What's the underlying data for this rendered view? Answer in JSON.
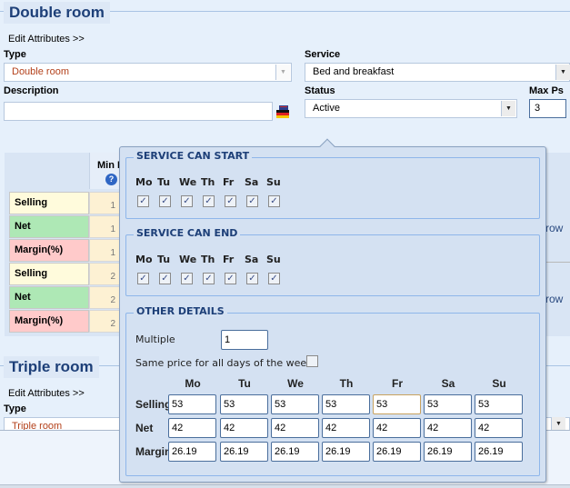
{
  "double_room": {
    "title": "Double room",
    "edit_attributes": "Edit Attributes >>",
    "type_label": "Type",
    "type_value": "Double room",
    "description_label": "Description",
    "description_value": "",
    "service_label": "Service",
    "service_value": "Bed and breakfast",
    "status_label": "Status",
    "status_value": "Active",
    "max_ps_label": "Max Ps",
    "max_ps_value": "3"
  },
  "grid": {
    "header": "Min I",
    "right_text_1": "row",
    "right_text_2": "row",
    "rows": [
      {
        "label": "Selling",
        "value": "1",
        "kind": "sell"
      },
      {
        "label": "Net",
        "value": "1",
        "kind": "net"
      },
      {
        "label": "Margin(%)",
        "value": "1",
        "kind": "marg"
      },
      {
        "label": "Selling",
        "value": "2",
        "kind": "sell"
      },
      {
        "label": "Net",
        "value": "2",
        "kind": "net"
      },
      {
        "label": "Margin(%)",
        "value": "2",
        "kind": "marg"
      }
    ]
  },
  "triple_room": {
    "title": "Triple room",
    "edit_attributes": "Edit Attributes >>",
    "type_label": "Type",
    "type_value": "Triple room"
  },
  "popup": {
    "service_can_start": {
      "title": "SERVICE CAN START",
      "days": [
        "Mo",
        "Tu",
        "We",
        "Th",
        "Fr",
        "Sa",
        "Su"
      ],
      "checked": [
        true,
        true,
        true,
        true,
        true,
        true,
        true
      ]
    },
    "service_can_end": {
      "title": "SERVICE CAN END",
      "days": [
        "Mo",
        "Tu",
        "We",
        "Th",
        "Fr",
        "Sa",
        "Su"
      ],
      "checked": [
        true,
        true,
        true,
        true,
        true,
        true,
        true
      ]
    },
    "other_details": {
      "title": "OTHER DETAILS",
      "multiple_label": "Multiple",
      "multiple_value": "1",
      "same_price_label": "Same price for all days of the week",
      "same_price_checked": false,
      "columns": [
        "Mo",
        "Tu",
        "We",
        "Th",
        "Fr",
        "Sa",
        "Su"
      ],
      "rows": [
        {
          "label": "Selling",
          "values": [
            "53",
            "53",
            "53",
            "53",
            "53",
            "53",
            "53"
          ]
        },
        {
          "label": "Net",
          "values": [
            "42",
            "42",
            "42",
            "42",
            "42",
            "42",
            "42"
          ]
        },
        {
          "label": "Margin",
          "values": [
            "26.19",
            "26.19",
            "26.19",
            "26.19",
            "26.19",
            "26.19",
            "26.19"
          ]
        }
      ]
    }
  },
  "colors": {
    "title": "#1d3f78",
    "type_value": "#b3401a",
    "selling_bg": "#fffbdc",
    "net_bg": "#aee8b5",
    "margin_bg": "#ffcaca"
  }
}
